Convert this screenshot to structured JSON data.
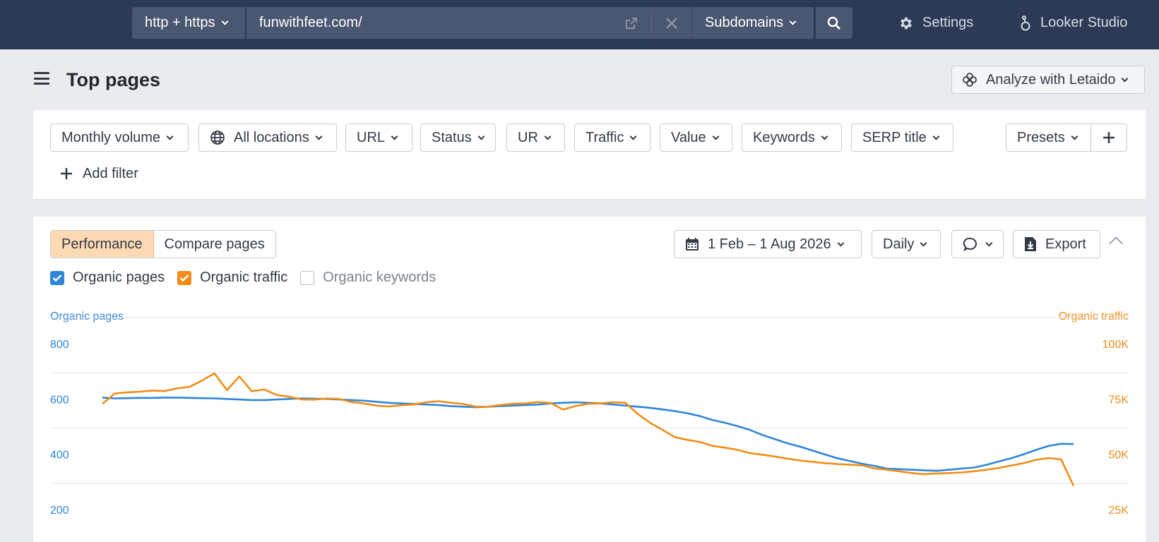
{
  "topbar": {
    "protocol": "http + https",
    "url_value": "funwithfeet.com/",
    "scope": "Subdomains",
    "settings_label": "Settings",
    "looker_label": "Looker Studio"
  },
  "page": {
    "title": "Top pages",
    "analyze_label": "Analyze with Letaido"
  },
  "filters": {
    "items": [
      "Monthly volume",
      "All locations",
      "URL",
      "Status",
      "UR",
      "Traffic",
      "Value",
      "Keywords",
      "SERP title"
    ],
    "presets_label": "Presets",
    "add_filter_label": "Add filter"
  },
  "chart_controls": {
    "tabs": [
      "Performance",
      "Compare pages"
    ],
    "date_range": "1 Feb – 1 Aug 2026",
    "interval": "Daily",
    "export_label": "Export",
    "checkboxes": [
      {
        "label": "Organic pages",
        "checked": true,
        "color": "#2f86d8"
      },
      {
        "label": "Organic traffic",
        "checked": true,
        "color": "#f28c16"
      },
      {
        "label": "Organic keywords",
        "checked": false
      }
    ]
  },
  "chart_data": {
    "type": "line",
    "x_range": [
      "1 Feb 2026",
      "1 Aug 2026"
    ],
    "left_axis": {
      "title": "Organic pages",
      "ticks": [
        "800",
        "600",
        "400",
        "200"
      ],
      "range": [
        200,
        800
      ],
      "color": "#2f86d8"
    },
    "right_axis": {
      "title": "Organic traffic",
      "ticks": [
        "100K",
        "75K",
        "50K",
        "25K"
      ],
      "range": [
        25000,
        100000
      ],
      "color": "#f28c16"
    },
    "grid": true,
    "series": [
      {
        "name": "Organic pages",
        "axis": "left",
        "color": "#2f86d8",
        "values": [
          605,
          602,
          603,
          604,
          604,
          605,
          605,
          604,
          603,
          602,
          600,
          598,
          596,
          596,
          598,
          600,
          602,
          601,
          600,
          598,
          596,
          594,
          590,
          586,
          584,
          582,
          580,
          578,
          574,
          572,
          570,
          572,
          574,
          576,
          578,
          580,
          584,
          586,
          588,
          586,
          584,
          580,
          576,
          572,
          568,
          562,
          556,
          548,
          538,
          524,
          514,
          502,
          488,
          470,
          455,
          440,
          428,
          414,
          400,
          386,
          376,
          366,
          358,
          348,
          346,
          344,
          342,
          340,
          344,
          348,
          352,
          362,
          374,
          386,
          400,
          416,
          430,
          438,
          437
        ]
      },
      {
        "name": "Organic traffic",
        "axis": "right",
        "color": "#f28c16",
        "values": [
          72800,
          77500,
          78000,
          78300,
          78800,
          78600,
          79800,
          80500,
          83300,
          86600,
          79000,
          85200,
          78500,
          79300,
          76800,
          76000,
          74800,
          74700,
          75200,
          75000,
          73600,
          73000,
          72000,
          71600,
          72200,
          72500,
          73500,
          74000,
          73300,
          72700,
          71500,
          71500,
          72300,
          72800,
          73000,
          73600,
          73200,
          70200,
          71800,
          72800,
          73000,
          73500,
          73300,
          68200,
          64200,
          61000,
          57700,
          56500,
          55500,
          53800,
          53000,
          52000,
          50500,
          49800,
          49000,
          48000,
          47200,
          46600,
          46000,
          45600,
          45300,
          45000,
          43600,
          43000,
          42300,
          41500,
          41000,
          41300,
          41500,
          41800,
          42300,
          43000,
          43800,
          44900,
          46000,
          47500,
          48300,
          47700,
          35700
        ]
      }
    ]
  }
}
